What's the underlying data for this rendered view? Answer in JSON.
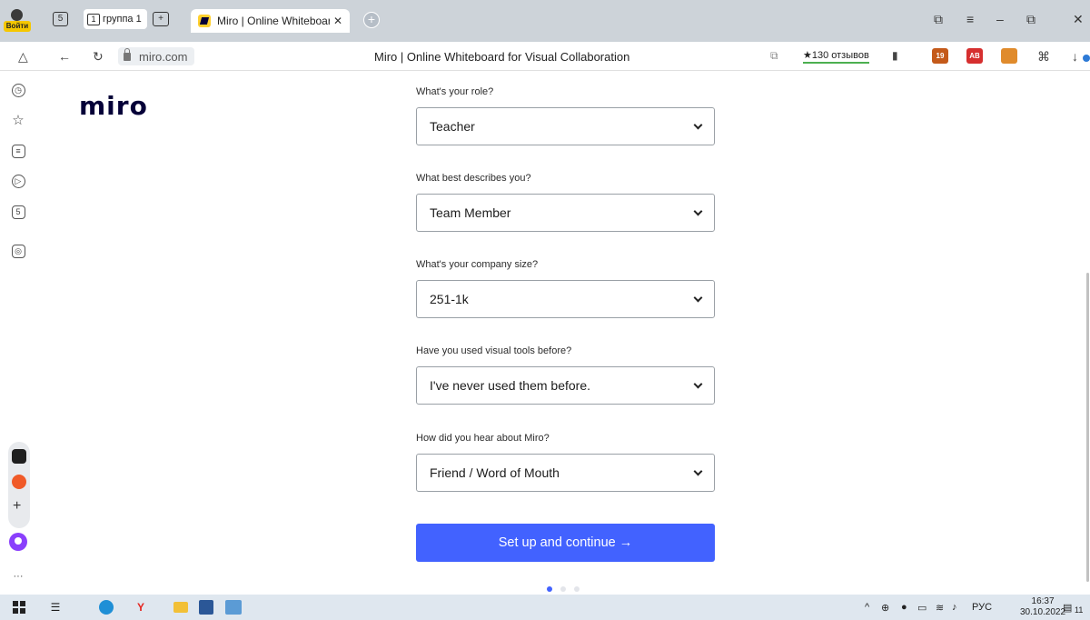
{
  "browser": {
    "profile_label": "Войти",
    "tab_group": {
      "count": "1",
      "label": "группа 1"
    },
    "tab_counter": "5",
    "active_tab": {
      "title": "Miro | Online Whiteboar",
      "close": "✕"
    },
    "new_tab": "+",
    "window_controls": [
      "⧉",
      "≡",
      "–",
      "⧉",
      "✕"
    ],
    "url": "miro.com",
    "page_title": "Miro | Online Whiteboard for Visual Collaboration",
    "reviews": "★130 отзывов",
    "extensions": [
      {
        "name": "ext-badge-19",
        "badge": "19",
        "color": "#c45a1a"
      },
      {
        "name": "ext-adblock",
        "badge": "AB",
        "color": "#d62f2f"
      },
      {
        "name": "ext-fox",
        "badge": "",
        "color": "#e08b2c"
      }
    ]
  },
  "sidebar": {
    "icons": [
      "bell-icon",
      "history-icon",
      "star-icon",
      "collections-icon",
      "play-icon",
      "counter-icon",
      "screenshot-icon"
    ],
    "more": "···"
  },
  "logo": "miro",
  "form": {
    "fields": [
      {
        "label": "What's your role?",
        "value": "Teacher"
      },
      {
        "label": "What best describes you?",
        "value": "Team Member"
      },
      {
        "label": "What's your company size?",
        "value": "251-1k"
      },
      {
        "label": "Have you used visual tools before?",
        "value": "I've never used them before."
      },
      {
        "label": "How did you hear about Miro?",
        "value": "Friend / Word of Mouth"
      }
    ],
    "submit_label": "Set up and continue →"
  },
  "pagination": {
    "total": 3,
    "active": 1
  },
  "taskbar": {
    "language": "РУС",
    "time": "16:37",
    "date": "30.10.2022",
    "notifications": "11"
  }
}
